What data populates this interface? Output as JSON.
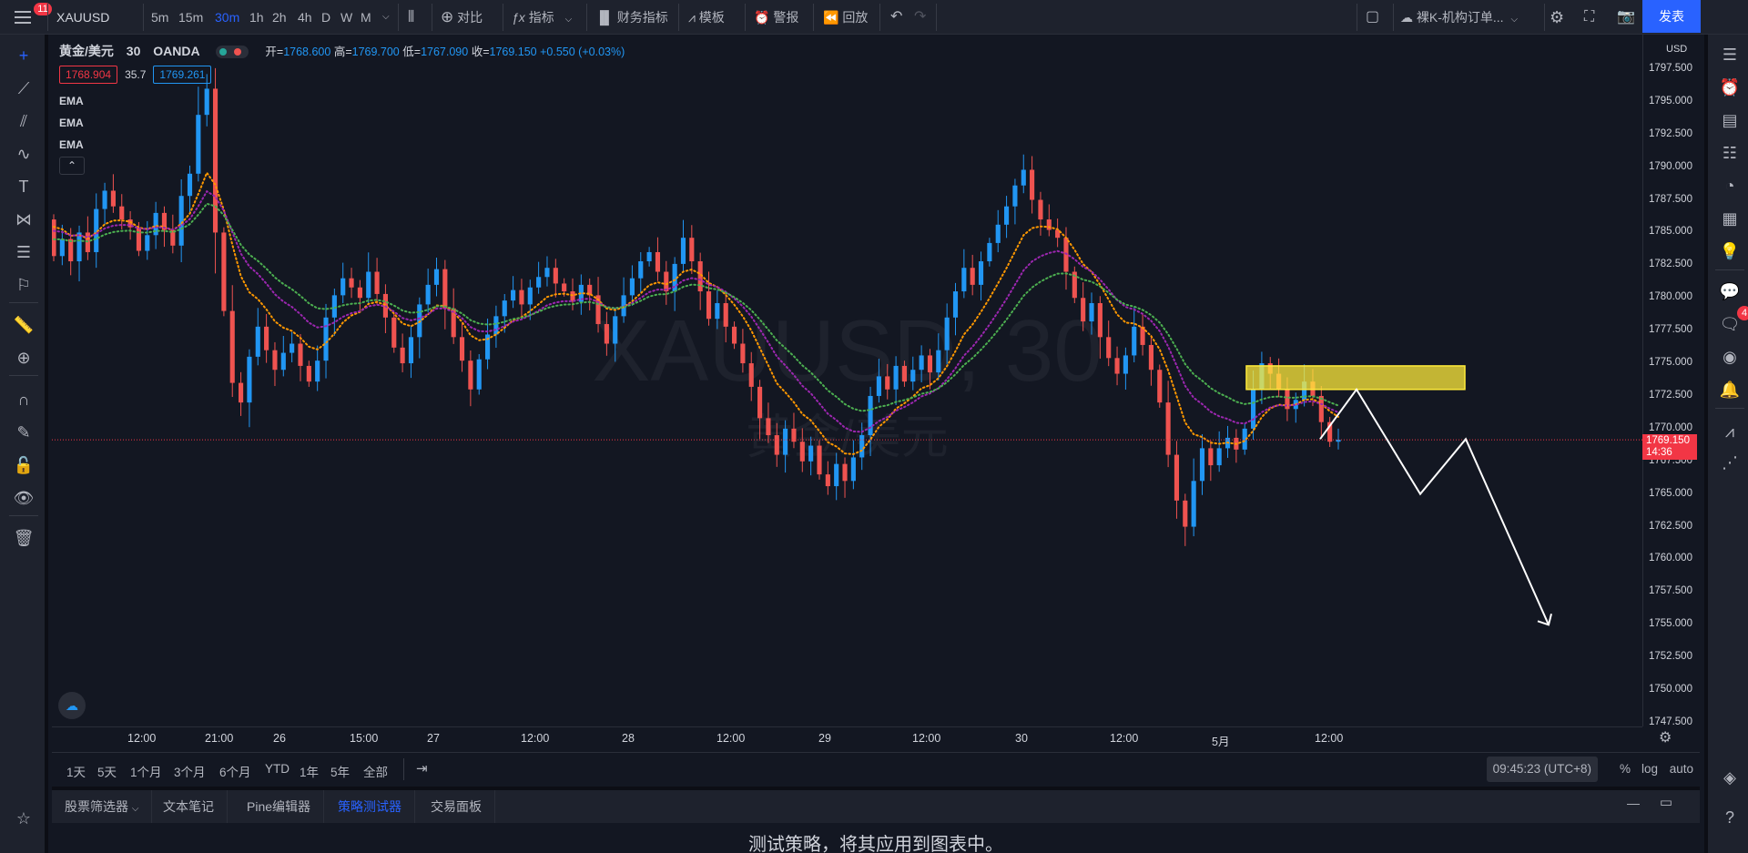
{
  "topbar": {
    "notif_count": "11",
    "symbol": "XAUUSD",
    "intervals": [
      "5m",
      "15m",
      "30m",
      "1h",
      "2h",
      "4h",
      "D",
      "W",
      "M"
    ],
    "active_interval": "30m",
    "compare": "对比",
    "indicators": "指标",
    "financials": "财务指标",
    "templates": "模板",
    "alerts": "警报",
    "replay": "回放",
    "layout_name": "裸K-机构订单...",
    "publish": "发表"
  },
  "legend": {
    "title": "黄金/美元",
    "interval": "30",
    "source": "OANDA",
    "open_label": "开=",
    "open": "1768.600",
    "high_label": "高=",
    "high": "1769.700",
    "low_label": "低=",
    "low": "1767.090",
    "close_label": "收=",
    "close": "1769.150",
    "change": "+0.550 (+0.03%)",
    "bid": "1768.904",
    "spread": "35.7",
    "ask": "1769.261",
    "indicators": [
      "EMA",
      "EMA",
      "EMA"
    ]
  },
  "watermark": {
    "symbol": "XAUUSD",
    "interval": "30",
    "name": "黄金/美元"
  },
  "price_axis": {
    "currency": "USD",
    "current_price": "1769.150",
    "countdown": "14:36"
  },
  "time_axis": {
    "labels": [
      "12:00",
      "21:00",
      "26",
      "15:00",
      "27",
      "12:00",
      "28",
      "12:00",
      "29",
      "12:00",
      "30",
      "12:00",
      "5月",
      "12:00"
    ]
  },
  "range_bar": {
    "ranges": [
      "1天",
      "5天",
      "1个月",
      "3个月",
      "6个月",
      "YTD",
      "1年",
      "5年",
      "全部"
    ],
    "clock": "09:45:23 (UTC+8)",
    "percent": "%",
    "log": "log",
    "auto": "auto"
  },
  "bottom": {
    "tabs": [
      "股票筛选器",
      "文本笔记",
      "Pine编辑器",
      "策略测试器",
      "交易面板"
    ],
    "active_tab": "策略测试器",
    "message": "测试策略，将其应用到图表中。"
  },
  "right_toolbar": {
    "chat_badge": "4"
  },
  "colors": {
    "background": "#131722",
    "up": "#2196f3",
    "down": "#ef5350",
    "ema_fast": "#ff9800",
    "ema_mid": "#9c27b0",
    "ema_slow": "#4caf50",
    "accent": "#2962ff",
    "zone": "#ffeb3b"
  },
  "chart_data": {
    "type": "candlestick",
    "symbol": "XAUUSD",
    "timeframe": "30",
    "ylim": [
      1747.5,
      1800.0
    ],
    "y_ticks": [
      "1797.500",
      "1795.000",
      "1792.500",
      "1790.000",
      "1787.500",
      "1785.000",
      "1782.500",
      "1780.000",
      "1777.500",
      "1775.000",
      "1772.500",
      "1770.000",
      "1767.500",
      "1765.000",
      "1762.500",
      "1760.000",
      "1757.500",
      "1755.000",
      "1752.500",
      "1750.000",
      "1747.500"
    ],
    "last_close": 1769.15,
    "closes": [
      1783.2,
      1784.5,
      1782.8,
      1785.0,
      1783.5,
      1786.8,
      1788.2,
      1787.0,
      1786.0,
      1785.4,
      1783.6,
      1784.8,
      1786.5,
      1785.2,
      1784.0,
      1787.8,
      1789.5,
      1794.0,
      1796.0,
      1785.0,
      1779.0,
      1773.5,
      1772.0,
      1775.5,
      1777.8,
      1776.0,
      1774.5,
      1775.8,
      1776.5,
      1774.8,
      1773.6,
      1775.2,
      1778.5,
      1780.2,
      1781.5,
      1780.8,
      1780.0,
      1782.0,
      1780.3,
      1778.5,
      1776.2,
      1775.0,
      1777.0,
      1779.5,
      1781.0,
      1782.2,
      1779.2,
      1777.0,
      1775.2,
      1773.0,
      1775.3,
      1777.2,
      1778.6,
      1779.8,
      1780.6,
      1779.5,
      1780.8,
      1781.6,
      1782.3,
      1781.1,
      1780.5,
      1779.7,
      1781.0,
      1780.2,
      1778.0,
      1776.5,
      1778.6,
      1780.2,
      1781.5,
      1782.8,
      1783.5,
      1782.0,
      1780.5,
      1782.6,
      1784.6,
      1782.8,
      1780.5,
      1778.4,
      1779.6,
      1777.8,
      1776.5,
      1775.0,
      1773.2,
      1770.8,
      1769.5,
      1768.0,
      1770.0,
      1769.0,
      1767.5,
      1768.7,
      1766.5,
      1765.6,
      1767.3,
      1766.0,
      1767.8,
      1769.5,
      1772.5,
      1774.0,
      1773.0,
      1774.8,
      1773.6,
      1774.5,
      1775.6,
      1774.3,
      1776.0,
      1778.5,
      1780.5,
      1782.3,
      1781.0,
      1782.8,
      1784.2,
      1785.6,
      1787.0,
      1788.6,
      1789.8,
      1787.5,
      1786.0,
      1785.2,
      1784.6,
      1782.0,
      1780.0,
      1778.2,
      1779.6,
      1777.0,
      1775.4,
      1774.2,
      1775.6,
      1777.8,
      1776.4,
      1774.5,
      1772.0,
      1768.0,
      1764.5,
      1762.5,
      1766.0,
      1768.5,
      1767.2,
      1768.5,
      1769.3,
      1768.4,
      1770.0,
      1773.0,
      1775.0,
      1774.2,
      1773.0,
      1771.5,
      1772.2,
      1773.6,
      1772.5,
      1770.5,
      1769.0,
      1769.15
    ],
    "ema_fast_start": 1786.0,
    "annotations": {
      "zone": {
        "y_low": 1773.0,
        "y_high": 1774.8
      },
      "projection_path_prices": [
        1769.2,
        1773.0,
        1765.0,
        1769.2,
        1755.0
      ]
    }
  }
}
